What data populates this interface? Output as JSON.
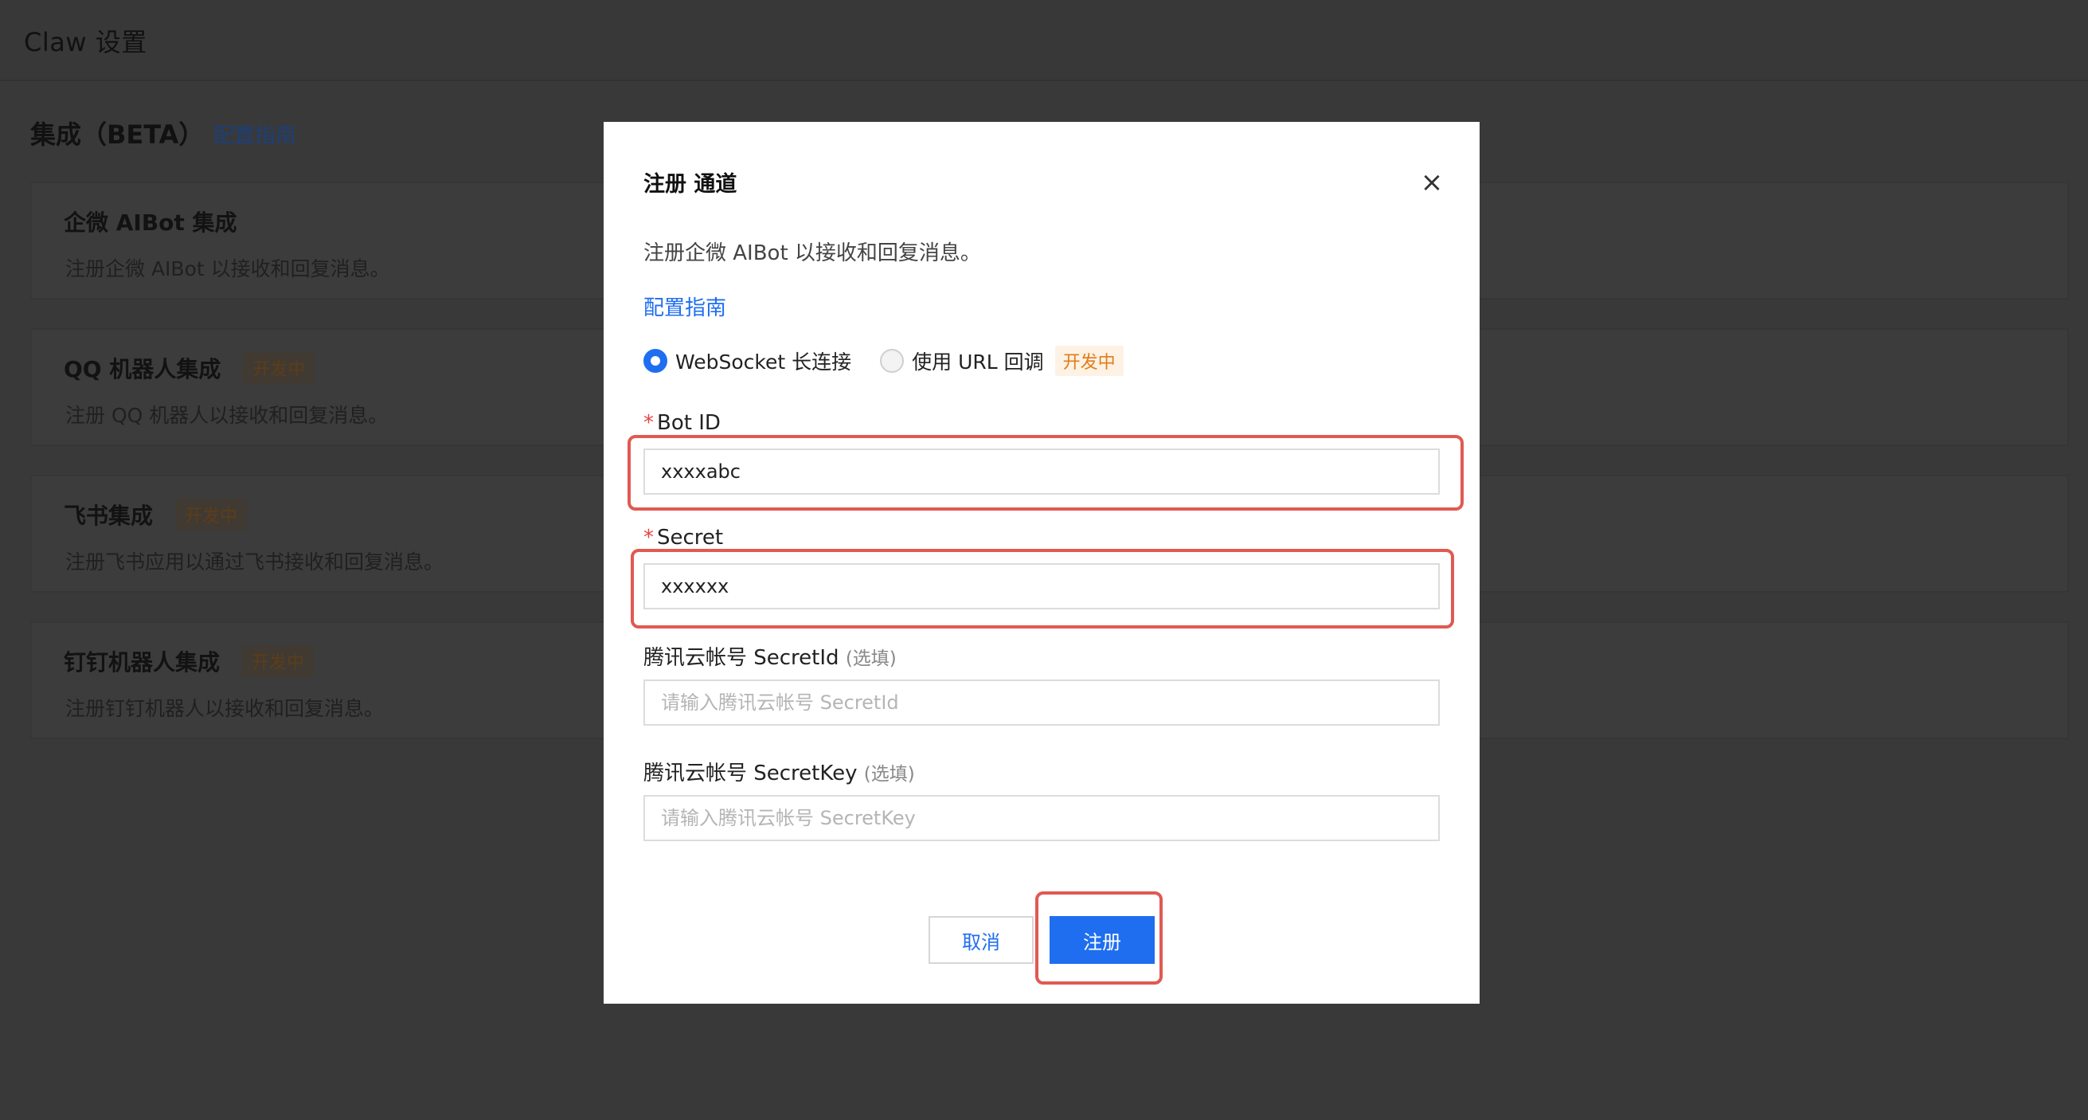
{
  "app": {
    "title": "Claw 设置"
  },
  "integration": {
    "section_title": "集成（BETA）",
    "guide_link": "配置指南",
    "cards": [
      {
        "title": "企微 AIBot 集成",
        "desc": "注册企微 AIBot 以接收和回复消息。",
        "badge": ""
      },
      {
        "title": "QQ 机器人集成",
        "desc": "注册 QQ 机器人以接收和回复消息。",
        "badge": "开发中"
      },
      {
        "title": "飞书集成",
        "desc": "注册飞书应用以通过飞书接收和回复消息。",
        "badge": "开发中"
      },
      {
        "title": "钉钉机器人集成",
        "desc": "注册钉钉机器人以接收和回复消息。",
        "badge": "开发中"
      }
    ]
  },
  "modal": {
    "title": "注册 通道",
    "close_symbol": "×",
    "description": "注册企微 AIBot 以接收和回复消息。",
    "guide_link": "配置指南",
    "connection_options": [
      {
        "label": "WebSocket 长连接",
        "checked": true
      },
      {
        "label": "使用 URL 回调",
        "checked": false,
        "badge": "开发中"
      }
    ],
    "fields": {
      "bot_id": {
        "label": "Bot ID",
        "required_mark": "*",
        "value": "xxxxabc",
        "placeholder": ""
      },
      "secret": {
        "label": "Secret",
        "required_mark": "*",
        "value": "xxxxxx",
        "placeholder": ""
      },
      "secret_id": {
        "label": "腾讯云帐号 SecretId",
        "optional": "(选填)",
        "value": "",
        "placeholder": "请输入腾讯云帐号 SecretId"
      },
      "secret_key": {
        "label": "腾讯云帐号 SecretKey",
        "optional": "(选填)",
        "value": "",
        "placeholder": "请输入腾讯云帐号 SecretKey"
      }
    },
    "buttons": {
      "cancel": "取消",
      "submit": "注册"
    }
  },
  "colors": {
    "primary": "#1f6ef0",
    "required": "#e54545",
    "highlight": "#e05a52",
    "dev_badge_text": "#e37c18",
    "dev_badge_bg": "#fdf2e4"
  }
}
